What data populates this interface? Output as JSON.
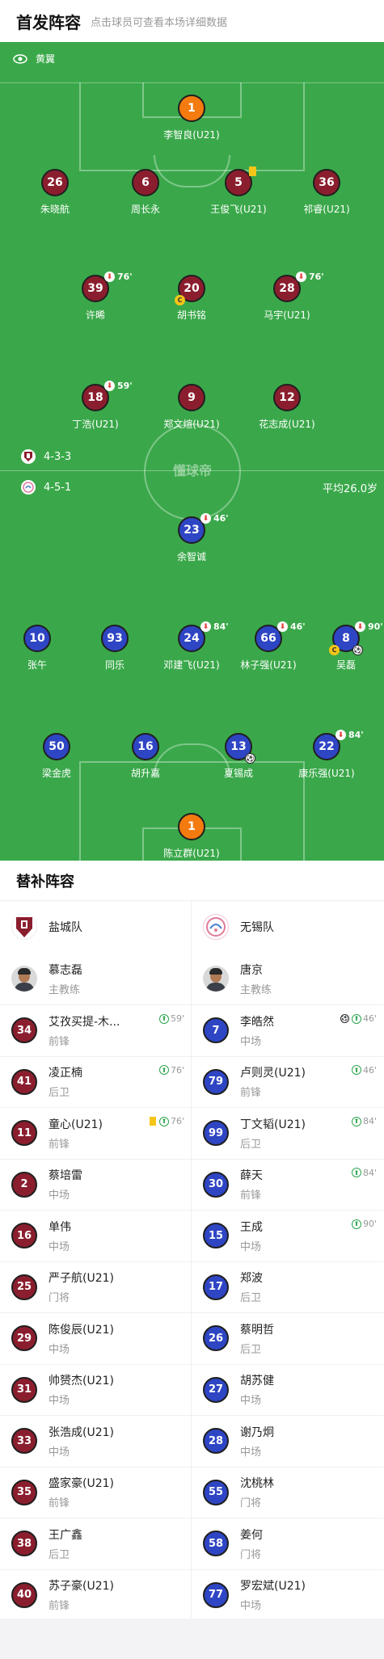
{
  "header": {
    "title": "首发阵容",
    "hint": "点击球员可查看本场详细数据"
  },
  "pitch": {
    "weather_label": "黄翼",
    "watermark": "懂球帝",
    "home_formation": "4-3-3",
    "away_formation": "4-5-1",
    "avg_age": "平均26.0岁"
  },
  "home_players": [
    {
      "num": "1",
      "name": "李智良(U21)",
      "gk": true
    },
    {
      "num": "26",
      "name": "朱晓航"
    },
    {
      "num": "6",
      "name": "周长永"
    },
    {
      "num": "5",
      "name": "王俊飞(U21)",
      "yellow": true
    },
    {
      "num": "36",
      "name": "祁睿(U21)"
    },
    {
      "num": "39",
      "name": "许晞",
      "sub": "76'"
    },
    {
      "num": "20",
      "name": "胡书铭",
      "captain": "C"
    },
    {
      "num": "28",
      "name": "马宇(U21)",
      "sub": "76'"
    },
    {
      "num": "18",
      "name": "丁浩(U21)",
      "sub": "59'"
    },
    {
      "num": "9",
      "name": "郑文煊(U21)"
    },
    {
      "num": "12",
      "name": "花志成(U21)"
    }
  ],
  "away_players": [
    {
      "num": "23",
      "name": "余智诚",
      "sub": "46'"
    },
    {
      "num": "10",
      "name": "张午"
    },
    {
      "num": "93",
      "name": "同乐"
    },
    {
      "num": "24",
      "name": "邓建飞(U21)",
      "sub": "84'"
    },
    {
      "num": "66",
      "name": "林子强(U21)",
      "sub": "46'"
    },
    {
      "num": "8",
      "name": "吴磊",
      "sub": "90'",
      "captain": "C",
      "goal": true
    },
    {
      "num": "50",
      "name": "梁金虎"
    },
    {
      "num": "16",
      "name": "胡升嘉"
    },
    {
      "num": "13",
      "name": "夏锡成",
      "goal": true
    },
    {
      "num": "22",
      "name": "康乐强(U21)",
      "sub": "84'"
    },
    {
      "num": "1",
      "name": "陈立群(U21)",
      "gk": true
    }
  ],
  "subs_title": "替补阵容",
  "home_team": {
    "name": "盐城队",
    "coach": "慕志磊",
    "coach_role": "主教练"
  },
  "away_team": {
    "name": "无锡队",
    "coach": "唐京",
    "coach_role": "主教练"
  },
  "home_subs": [
    {
      "num": "34",
      "name": "艾孜买提-木...",
      "pos": "前锋",
      "in": "59'"
    },
    {
      "num": "41",
      "name": "凌正楠",
      "pos": "后卫",
      "in": "76'"
    },
    {
      "num": "11",
      "name": "童心(U21)",
      "pos": "前锋",
      "in": "76'",
      "yellow": true
    },
    {
      "num": "2",
      "name": "蔡培雷",
      "pos": "中场"
    },
    {
      "num": "16",
      "name": "单伟",
      "pos": "中场"
    },
    {
      "num": "25",
      "name": "严子航(U21)",
      "pos": "门将"
    },
    {
      "num": "29",
      "name": "陈俊辰(U21)",
      "pos": "中场"
    },
    {
      "num": "31",
      "name": "帅赟杰(U21)",
      "pos": "中场"
    },
    {
      "num": "33",
      "name": "张浩成(U21)",
      "pos": "中场"
    },
    {
      "num": "35",
      "name": "盛家豪(U21)",
      "pos": "前锋"
    },
    {
      "num": "38",
      "name": "王广鑫",
      "pos": "后卫"
    },
    {
      "num": "40",
      "name": "苏子豪(U21)",
      "pos": "前锋"
    }
  ],
  "away_subs": [
    {
      "num": "7",
      "name": "李皓然",
      "pos": "中场",
      "in": "46'",
      "goal": true
    },
    {
      "num": "79",
      "name": "卢则灵(U21)",
      "pos": "前锋",
      "in": "46'"
    },
    {
      "num": "99",
      "name": "丁文韬(U21)",
      "pos": "后卫",
      "in": "84'"
    },
    {
      "num": "30",
      "name": "薛天",
      "pos": "前锋",
      "in": "84'"
    },
    {
      "num": "15",
      "name": "王成",
      "pos": "中场",
      "in": "90'"
    },
    {
      "num": "17",
      "name": "郑波",
      "pos": "后卫"
    },
    {
      "num": "26",
      "name": "蔡明哲",
      "pos": "后卫"
    },
    {
      "num": "27",
      "name": "胡苏健",
      "pos": "中场"
    },
    {
      "num": "28",
      "name": "谢乃炯",
      "pos": "中场"
    },
    {
      "num": "55",
      "name": "沈桃林",
      "pos": "门将"
    },
    {
      "num": "58",
      "name": "姜何",
      "pos": "门将"
    },
    {
      "num": "77",
      "name": "罗宏斌(U21)",
      "pos": "中场"
    }
  ]
}
